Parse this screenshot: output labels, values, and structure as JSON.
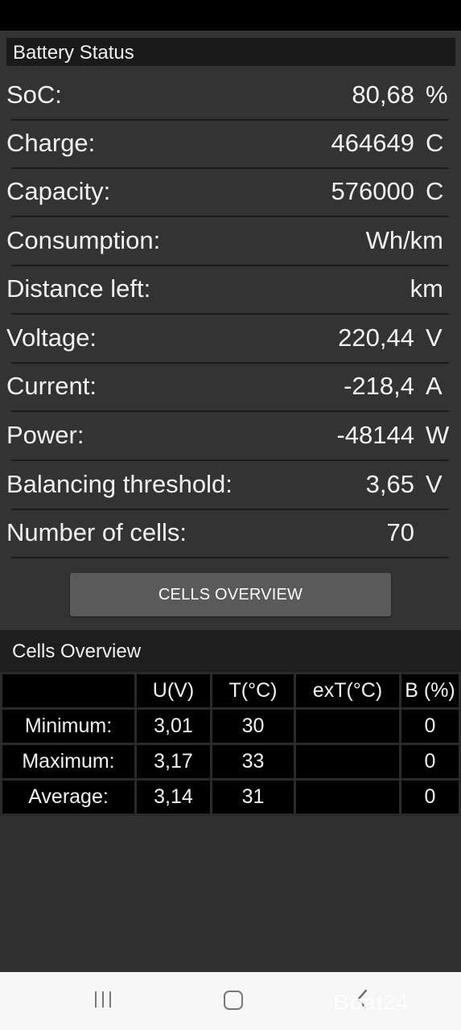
{
  "panel": {
    "title": "Battery Status",
    "rows": [
      {
        "label": "SoC:",
        "value": "80,68",
        "unit": "%"
      },
      {
        "label": "Charge:",
        "value": "464649",
        "unit": "C"
      },
      {
        "label": "Capacity:",
        "value": "576000",
        "unit": "C"
      },
      {
        "label": "Consumption:",
        "value": "Wh/km",
        "unit": ""
      },
      {
        "label": "Distance left:",
        "value": "km",
        "unit": ""
      },
      {
        "label": "Voltage:",
        "value": "220,44",
        "unit": "V"
      },
      {
        "label": "Current:",
        "value": "-218,4",
        "unit": "A"
      },
      {
        "label": "Power:",
        "value": "-48144",
        "unit": "W"
      },
      {
        "label": "Balancing threshold:",
        "value": "3,65",
        "unit": "V"
      },
      {
        "label": "Number of cells:",
        "value": "70",
        "unit": ""
      }
    ],
    "button_label": "CELLS OVERVIEW"
  },
  "cells": {
    "title": "Cells Overview",
    "columns": [
      "",
      "U(V)",
      "T(°C)",
      "exT(°C)",
      "B (%)"
    ],
    "rows": [
      [
        "Minimum:",
        "3,01",
        "30",
        "",
        "0"
      ],
      [
        "Maximum:",
        "3,17",
        "33",
        "",
        "0"
      ],
      [
        "Average:",
        "3,14",
        "31",
        "",
        "0"
      ]
    ]
  },
  "nav": {
    "recents_icon": "recents-icon",
    "home_icon": "home-icon",
    "back_icon": "back-icon",
    "watermark": "Boat24"
  }
}
